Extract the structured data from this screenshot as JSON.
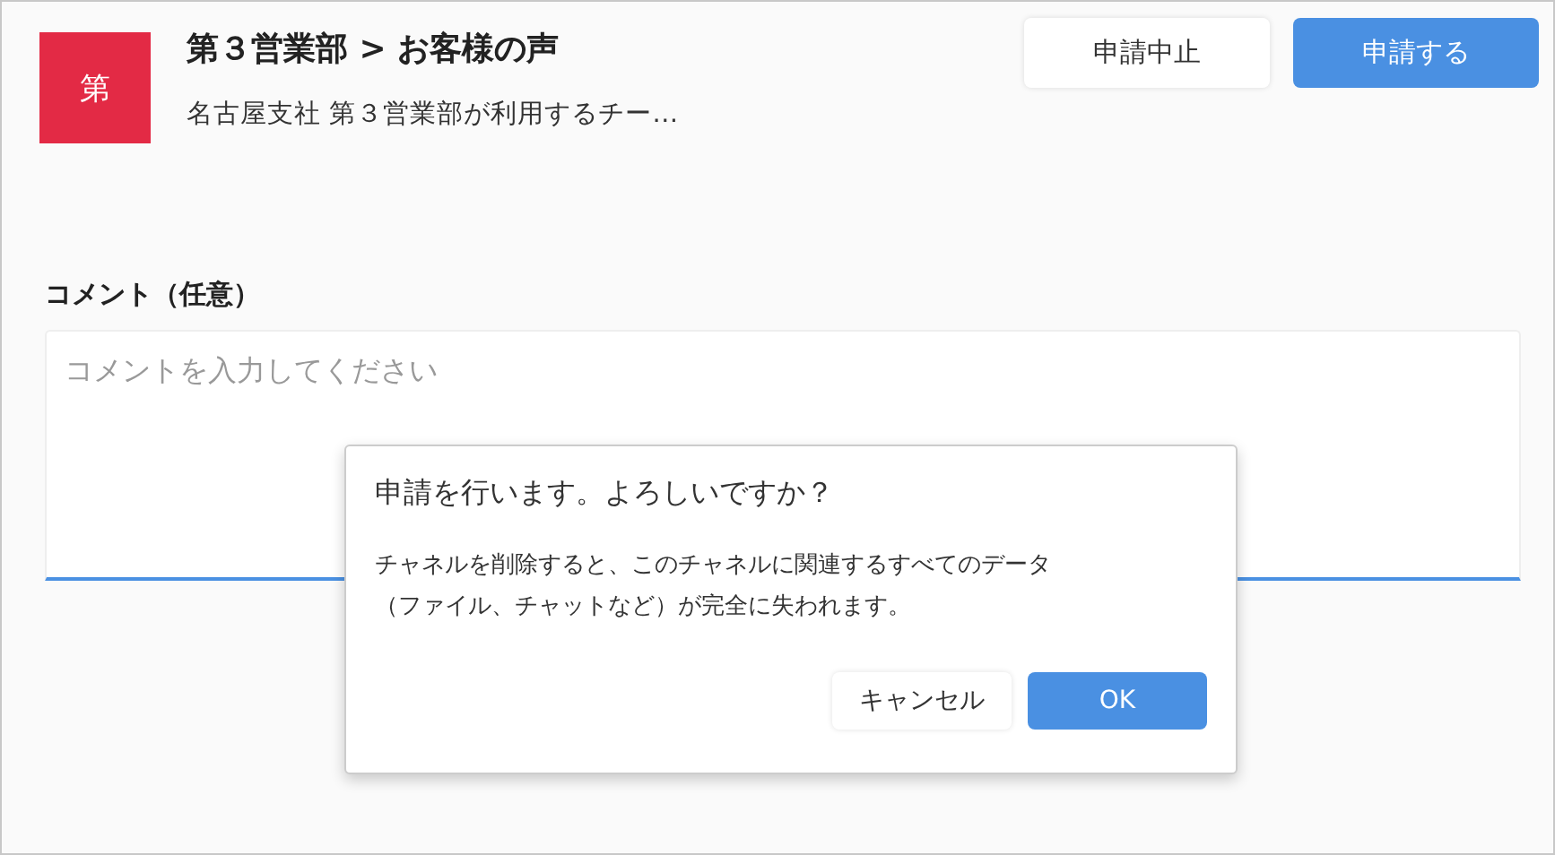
{
  "header": {
    "avatar": "第",
    "title": "第３営業部 > お客様の声",
    "subtitle": "名古屋支社 第３営業部が利用するチー…",
    "buttons": [
      {
        "label": "申請中止",
        "kind": "secondary"
      },
      {
        "label": "申請する",
        "kind": "primary"
      }
    ]
  },
  "comment": {
    "label": "コメント（任意）",
    "placeholder": "コメントを入力してください"
  },
  "dialog": {
    "title": "申請を行います。よろしいですか？",
    "message": [
      "チャネルを削除すると、このチャネルに関連するすべてのデータ",
      "（ファイル、チャットなど）が完全に失われます。"
    ],
    "buttons": [
      {
        "label": "キャンセル",
        "kind": "secondary"
      },
      {
        "label": "OK",
        "kind": "primary"
      }
    ]
  }
}
